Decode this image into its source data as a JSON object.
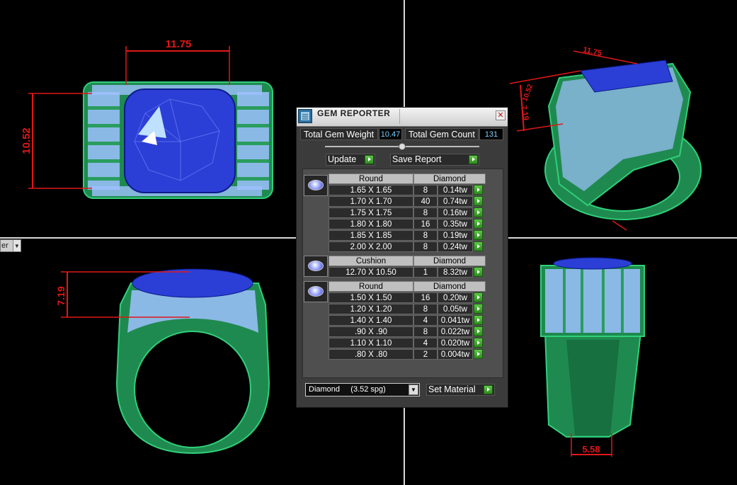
{
  "viewport": {
    "tag_label": "er",
    "dimensions": {
      "top_left_width": "11.75",
      "top_left_height": "10.52",
      "bottom_left_height": "7.19",
      "top_right_width": "11.75",
      "top_right_depth": "10.52",
      "top_right_height": "7.19",
      "bottom_right_width": "5.58"
    },
    "colors": {
      "metal": "#1f8a4f",
      "gem": "#2b3fd6",
      "pave": "#9fc1ff",
      "dimension": "#e01818"
    }
  },
  "panel": {
    "title": "GEM REPORTER",
    "close_icon": "close-icon",
    "total_weight_label": "Total Gem Weight",
    "total_weight_value": "10.47",
    "total_count_label": "Total Gem Count",
    "total_count_value": "131",
    "update_label": "Update",
    "save_report_label": "Save Report",
    "groups": [
      {
        "shape": "Round",
        "material": "Diamond",
        "rows": [
          {
            "size": "1.65 X 1.65",
            "count": "8",
            "weight": "0.14tw"
          },
          {
            "size": "1.70 X 1.70",
            "count": "40",
            "weight": "0.74tw"
          },
          {
            "size": "1.75 X 1.75",
            "count": "8",
            "weight": "0.16tw"
          },
          {
            "size": "1.80 X 1.80",
            "count": "16",
            "weight": "0.35tw"
          },
          {
            "size": "1.85 X 1.85",
            "count": "8",
            "weight": "0.19tw"
          },
          {
            "size": "2.00 X 2.00",
            "count": "8",
            "weight": "0.24tw"
          }
        ]
      },
      {
        "shape": "Cushion",
        "material": "Diamond",
        "rows": [
          {
            "size": "12.70 X 10.50",
            "count": "1",
            "weight": "8.32tw"
          }
        ]
      },
      {
        "shape": "Round",
        "material": "Diamond",
        "rows": [
          {
            "size": "1.50 X 1.50",
            "count": "16",
            "weight": "0.20tw"
          },
          {
            "size": "1.20 X 1.20",
            "count": "8",
            "weight": "0.05tw"
          },
          {
            "size": "1.40 X 1.40",
            "count": "4",
            "weight": "0.041tw"
          },
          {
            "size": ".90 X .90",
            "count": "8",
            "weight": "0.022tw"
          },
          {
            "size": "1.10 X 1.10",
            "count": "4",
            "weight": "0.020tw"
          },
          {
            "size": ".80 X .80",
            "count": "2",
            "weight": "0.004tw"
          }
        ]
      }
    ],
    "material_select": "Diamond     (3.52 spg)",
    "set_material_label": "Set Material"
  }
}
